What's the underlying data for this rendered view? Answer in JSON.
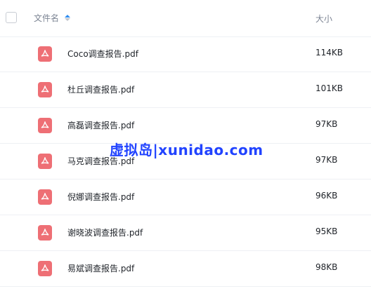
{
  "header": {
    "name_label": "文件名",
    "size_label": "大小"
  },
  "files": [
    {
      "name": "Coco调查报告.pdf",
      "size": "114KB",
      "icon": "pdf-icon"
    },
    {
      "name": "杜丘调查报告.pdf",
      "size": "101KB",
      "icon": "pdf-icon"
    },
    {
      "name": "高磊调查报告.pdf",
      "size": "97KB",
      "icon": "pdf-icon"
    },
    {
      "name": "马克调查报告.pdf",
      "size": "97KB",
      "icon": "pdf-icon"
    },
    {
      "name": "倪娜调查报告.pdf",
      "size": "96KB",
      "icon": "pdf-icon"
    },
    {
      "name": "谢晓波调查报告.pdf",
      "size": "95KB",
      "icon": "pdf-icon"
    },
    {
      "name": "易斌调查报告.pdf",
      "size": "98KB",
      "icon": "pdf-icon"
    }
  ],
  "watermark": "虚拟岛|xunidao.com",
  "colors": {
    "pdf": "#ee6f75",
    "sort_active": "#2d8cf0",
    "watermark": "#2143ff"
  }
}
